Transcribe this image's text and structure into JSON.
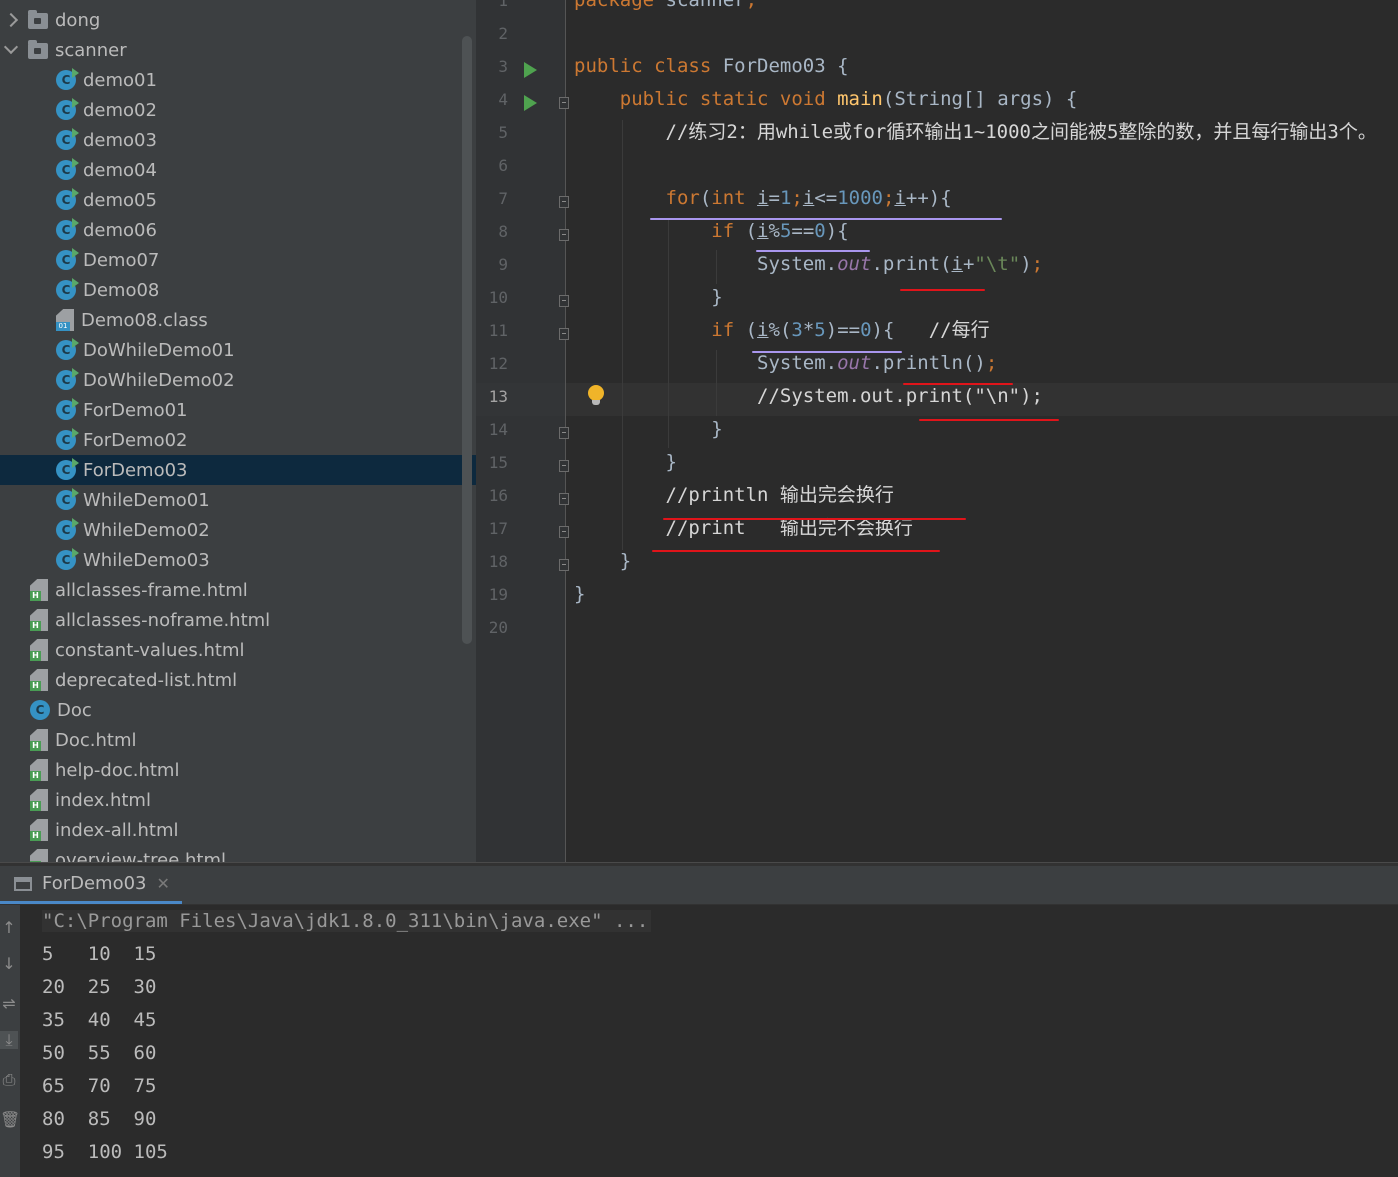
{
  "project_tree": {
    "items": [
      {
        "label": "dong",
        "kind": "folder",
        "arrow": "right",
        "indent": 0
      },
      {
        "label": "scanner",
        "kind": "folder",
        "arrow": "down",
        "indent": 0
      },
      {
        "label": "demo01",
        "kind": "class",
        "indent": 1
      },
      {
        "label": "demo02",
        "kind": "class",
        "indent": 1
      },
      {
        "label": "demo03",
        "kind": "class",
        "indent": 1
      },
      {
        "label": "demo04",
        "kind": "class",
        "indent": 1
      },
      {
        "label": "demo05",
        "kind": "class",
        "indent": 1
      },
      {
        "label": "demo06",
        "kind": "class",
        "indent": 1
      },
      {
        "label": "Demo07",
        "kind": "class",
        "indent": 1
      },
      {
        "label": "Demo08",
        "kind": "class",
        "indent": 1
      },
      {
        "label": "Demo08.class",
        "kind": "binary",
        "indent": 1
      },
      {
        "label": "DoWhileDemo01",
        "kind": "class",
        "indent": 1
      },
      {
        "label": "DoWhileDemo02",
        "kind": "class",
        "indent": 1
      },
      {
        "label": "ForDemo01",
        "kind": "class",
        "indent": 1
      },
      {
        "label": "ForDemo02",
        "kind": "class",
        "indent": 1
      },
      {
        "label": "ForDemo03",
        "kind": "class",
        "indent": 1,
        "selected": true
      },
      {
        "label": "WhileDemo01",
        "kind": "class",
        "indent": 1
      },
      {
        "label": "WhileDemo02",
        "kind": "class",
        "indent": 1
      },
      {
        "label": "WhileDemo03",
        "kind": "class",
        "indent": 1
      },
      {
        "label": "allclasses-frame.html",
        "kind": "html",
        "indent": 0
      },
      {
        "label": "allclasses-noframe.html",
        "kind": "html",
        "indent": 0
      },
      {
        "label": "constant-values.html",
        "kind": "html",
        "indent": 0
      },
      {
        "label": "deprecated-list.html",
        "kind": "html",
        "indent": 0
      },
      {
        "label": "Doc",
        "kind": "plainclass",
        "indent": 0
      },
      {
        "label": "Doc.html",
        "kind": "html",
        "indent": 0
      },
      {
        "label": "help-doc.html",
        "kind": "html",
        "indent": 0
      },
      {
        "label": "index.html",
        "kind": "html",
        "indent": 0
      },
      {
        "label": "index-all.html",
        "kind": "html",
        "indent": 0
      },
      {
        "label": "overview-tree.html",
        "kind": "html",
        "indent": 0
      }
    ]
  },
  "editor": {
    "current_line": 13,
    "lines": [
      {
        "n": 1,
        "tokens": [
          {
            "t": "package ",
            "c": "kw"
          },
          {
            "t": "scanner",
            "c": ""
          },
          {
            "t": ";",
            "c": "kw"
          }
        ]
      },
      {
        "n": 2,
        "tokens": []
      },
      {
        "n": 3,
        "tokens": [
          {
            "t": "public class ",
            "c": "kw"
          },
          {
            "t": "ForDemo03 {",
            "c": ""
          }
        ]
      },
      {
        "n": 4,
        "tokens": [
          {
            "t": "    public static void ",
            "c": "kw"
          },
          {
            "t": "main",
            "c": "fn"
          },
          {
            "t": "(String[] args) {",
            "c": ""
          }
        ]
      },
      {
        "n": 5,
        "tokens": [
          {
            "t": "        //练习2：用while或for循环输出1~1000之间能被5整除的数，并且每行输出3个。",
            "c": "cm"
          }
        ]
      },
      {
        "n": 6,
        "tokens": []
      },
      {
        "n": 7,
        "tokens": [
          {
            "t": "        for",
            "c": "kw"
          },
          {
            "t": "(",
            "c": ""
          },
          {
            "t": "int ",
            "c": "kw"
          },
          {
            "t": "i",
            "c": "var"
          },
          {
            "t": "=",
            "c": ""
          },
          {
            "t": "1",
            "c": "num"
          },
          {
            "t": ";",
            "c": "kw"
          },
          {
            "t": "i",
            "c": "var"
          },
          {
            "t": "<=",
            "c": ""
          },
          {
            "t": "1000",
            "c": "num"
          },
          {
            "t": ";",
            "c": "kw"
          },
          {
            "t": "i",
            "c": "var"
          },
          {
            "t": "++){",
            "c": ""
          }
        ]
      },
      {
        "n": 8,
        "tokens": [
          {
            "t": "            if ",
            "c": "kw"
          },
          {
            "t": "(",
            "c": ""
          },
          {
            "t": "i",
            "c": "var"
          },
          {
            "t": "%",
            "c": ""
          },
          {
            "t": "5",
            "c": "num"
          },
          {
            "t": "==",
            "c": ""
          },
          {
            "t": "0",
            "c": "num"
          },
          {
            "t": "){",
            "c": ""
          }
        ]
      },
      {
        "n": 9,
        "tokens": [
          {
            "t": "                System.",
            "c": ""
          },
          {
            "t": "out",
            "c": "fld"
          },
          {
            "t": ".print(",
            "c": ""
          },
          {
            "t": "i",
            "c": "var"
          },
          {
            "t": "+",
            "c": ""
          },
          {
            "t": "\"\\t\"",
            "c": "str"
          },
          {
            "t": ")",
            "c": ""
          },
          {
            "t": ";",
            "c": "kw"
          }
        ]
      },
      {
        "n": 10,
        "tokens": [
          {
            "t": "            }",
            "c": ""
          }
        ]
      },
      {
        "n": 11,
        "tokens": [
          {
            "t": "            if ",
            "c": "kw"
          },
          {
            "t": "(",
            "c": ""
          },
          {
            "t": "i",
            "c": "var"
          },
          {
            "t": "%(",
            "c": ""
          },
          {
            "t": "3",
            "c": "num"
          },
          {
            "t": "*",
            "c": ""
          },
          {
            "t": "5",
            "c": "num"
          },
          {
            "t": ")==",
            "c": ""
          },
          {
            "t": "0",
            "c": "num"
          },
          {
            "t": "){   ",
            "c": ""
          },
          {
            "t": "//每行",
            "c": "cm"
          }
        ]
      },
      {
        "n": 12,
        "tokens": [
          {
            "t": "                System.",
            "c": ""
          },
          {
            "t": "out",
            "c": "fld"
          },
          {
            "t": ".println()",
            "c": ""
          },
          {
            "t": ";",
            "c": "kw"
          }
        ]
      },
      {
        "n": 13,
        "tokens": [
          {
            "t": "                //System.out.print(\"\\n\");",
            "c": "cm"
          }
        ]
      },
      {
        "n": 14,
        "tokens": [
          {
            "t": "            }",
            "c": ""
          }
        ]
      },
      {
        "n": 15,
        "tokens": [
          {
            "t": "        }",
            "c": ""
          }
        ]
      },
      {
        "n": 16,
        "tokens": [
          {
            "t": "        //println 输出完会换行",
            "c": "cm"
          }
        ]
      },
      {
        "n": 17,
        "tokens": [
          {
            "t": "        //print   输出完不会换行",
            "c": "cm"
          }
        ]
      },
      {
        "n": 18,
        "tokens": [
          {
            "t": "    }",
            "c": ""
          }
        ]
      },
      {
        "n": 19,
        "tokens": [
          {
            "t": "}",
            "c": ""
          }
        ]
      },
      {
        "n": 20,
        "tokens": []
      }
    ]
  },
  "run_panel": {
    "tab_label": "ForDemo03",
    "command": "\"C:\\Program Files\\Java\\jdk1.8.0_311\\bin\\java.exe\" ...",
    "output_lines": [
      "5\t10\t15",
      "20\t25\t30",
      "35\t40\t45",
      "50\t55\t60",
      "65\t70\t75",
      "80\t85\t90",
      "95\t100\t105"
    ]
  }
}
